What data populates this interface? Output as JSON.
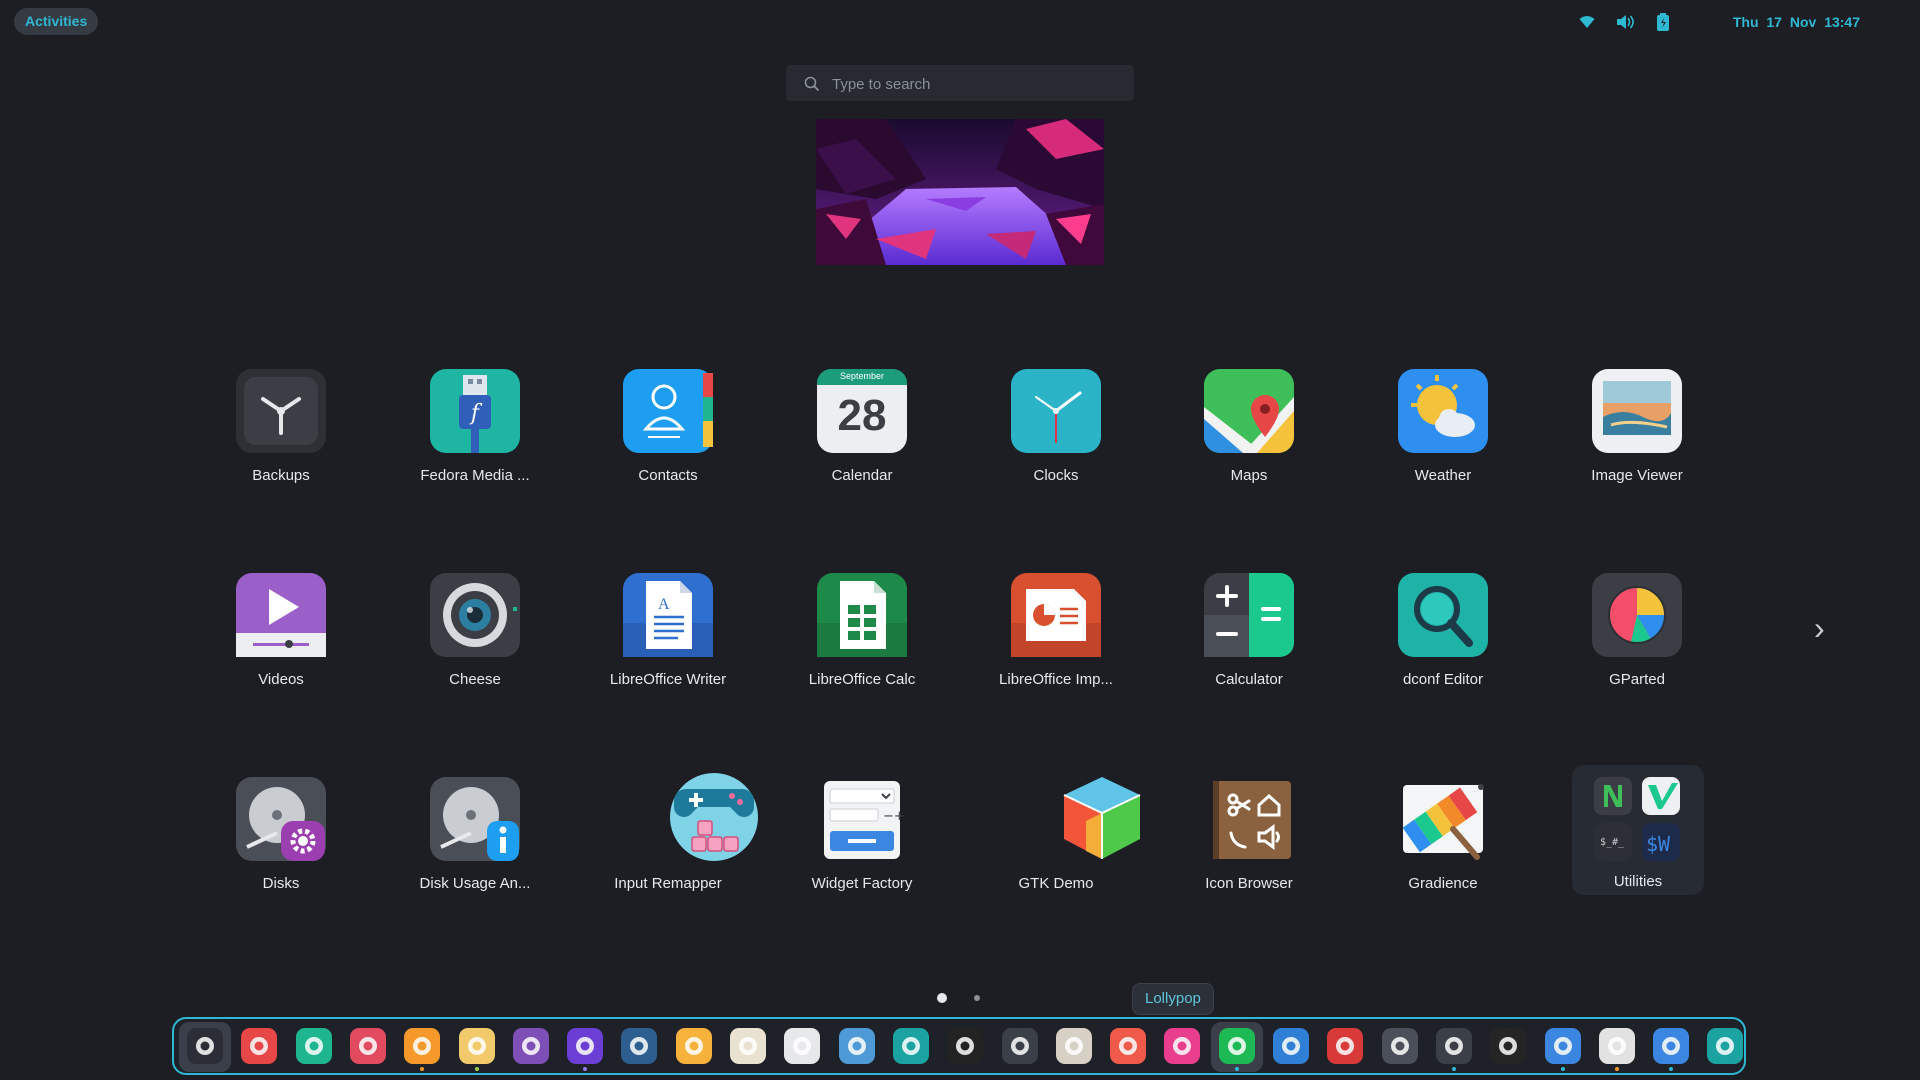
{
  "topbar": {
    "activities_label": "Activities",
    "clock": "Thu 17 Nov  13:47",
    "tray_icons": [
      "wifi-icon",
      "volume-icon",
      "battery-icon"
    ],
    "accent_color": "#2fb8d2"
  },
  "search": {
    "placeholder": "Type to search",
    "value": ""
  },
  "apps": [
    {
      "label": "Backups",
      "icon": "backups-icon"
    },
    {
      "label": "Fedora Media ...",
      "icon": "usb-icon"
    },
    {
      "label": "Contacts",
      "icon": "contacts-icon"
    },
    {
      "label": "Calendar",
      "icon": "calendar-icon",
      "calendar_month": "September",
      "calendar_day": "28"
    },
    {
      "label": "Clocks",
      "icon": "clock-icon"
    },
    {
      "label": "Maps",
      "icon": "maps-icon"
    },
    {
      "label": "Weather",
      "icon": "weather-icon"
    },
    {
      "label": "Image Viewer",
      "icon": "image-viewer-icon"
    },
    {
      "label": "Videos",
      "icon": "videos-icon"
    },
    {
      "label": "Cheese",
      "icon": "camera-icon"
    },
    {
      "label": "LibreOffice Writer",
      "icon": "writer-icon"
    },
    {
      "label": "LibreOffice Calc",
      "icon": "calc-icon"
    },
    {
      "label": "LibreOffice Imp...",
      "icon": "impress-icon"
    },
    {
      "label": "Calculator",
      "icon": "calculator-icon"
    },
    {
      "label": "dconf Editor",
      "icon": "dconf-icon"
    },
    {
      "label": "GParted",
      "icon": "gparted-icon"
    },
    {
      "label": "Disks",
      "icon": "disks-icon"
    },
    {
      "label": "Disk Usage An...",
      "icon": "disk-usage-icon"
    },
    {
      "label": "Input Remapper",
      "icon": "gamepad-icon"
    },
    {
      "label": "Widget Factory",
      "icon": "widget-factory-icon"
    },
    {
      "label": "GTK Demo",
      "icon": "gtk-cube-icon"
    },
    {
      "label": "Icon Browser",
      "icon": "icon-browser-icon"
    },
    {
      "label": "Gradience",
      "icon": "gradience-icon"
    },
    {
      "label": "Utilities",
      "icon": "folder-icon",
      "folder": true
    }
  ],
  "pager": {
    "pages": 2,
    "current": 1
  },
  "tooltip": "Lollypop",
  "dock": [
    {
      "name": "lollypop",
      "icon": "bird-icon",
      "color": "#2b2e36",
      "selected": true
    },
    {
      "name": "app-store",
      "icon": "appstore-icon",
      "color": "#e84747"
    },
    {
      "name": "mail",
      "icon": "mail-icon",
      "color": "#1fb68f"
    },
    {
      "name": "tasks",
      "icon": "check-icon",
      "color": "#e24a5f"
    },
    {
      "name": "brave",
      "icon": "brave-icon",
      "color": "#f59a2a",
      "running_color": "#f59a2a"
    },
    {
      "name": "files",
      "icon": "folder-icon",
      "color": "#f2c96b",
      "running_color": "#9ccf4f"
    },
    {
      "name": "github",
      "icon": "github-icon",
      "color": "#7f4fb8"
    },
    {
      "name": "obsidian",
      "icon": "gem-icon",
      "color": "#6b3ed6",
      "running_color": "#9b7bf0"
    },
    {
      "name": "vscode",
      "icon": "vscode-icon",
      "color": "#2c5f8f"
    },
    {
      "name": "color-picker",
      "icon": "color-picker-icon",
      "color": "#f6b23a"
    },
    {
      "name": "text-editor",
      "icon": "pencil-icon",
      "color": "#e9e2d0"
    },
    {
      "name": "search-tool",
      "icon": "magnifier-icon",
      "color": "#e6e8ec"
    },
    {
      "name": "reader",
      "icon": "book-icon",
      "color": "#4e9ad6"
    },
    {
      "name": "screenshot",
      "icon": "screenshot-icon",
      "color": "#1aa3a0"
    },
    {
      "name": "figma",
      "icon": "figma-icon",
      "color": "#232323"
    },
    {
      "name": "inkscape",
      "icon": "inkscape-icon",
      "color": "#3b3f47"
    },
    {
      "name": "gimp",
      "icon": "gimp-icon",
      "color": "#d7d0c4"
    },
    {
      "name": "pinta",
      "icon": "pinta-icon",
      "color": "#f05a4a"
    },
    {
      "name": "collage",
      "icon": "pinwheel-icon",
      "color": "#e83e8c"
    },
    {
      "name": "spotify",
      "icon": "spotify-icon",
      "color": "#1db954",
      "running_color": "#2fb8d2",
      "selected": true
    },
    {
      "name": "equalizer",
      "icon": "sliders-icon",
      "color": "#2f7fd6"
    },
    {
      "name": "sound-recorder",
      "icon": "waveform-icon",
      "color": "#d83a3a"
    },
    {
      "name": "window-tool",
      "icon": "frame-icon",
      "color": "#4a4f59"
    },
    {
      "name": "terminal",
      "icon": "terminal-icon",
      "color": "#3b3f47",
      "running_color": "#2fb8d2"
    },
    {
      "name": "ardour",
      "icon": "ardour-icon",
      "color": "#252525"
    },
    {
      "name": "extensions",
      "icon": "puzzle-icon",
      "color": "#3b86e0",
      "running_color": "#2fb8d2"
    },
    {
      "name": "layout-tool",
      "icon": "layout-icon",
      "color": "#e2e2e2",
      "running_color": "#f59a2a"
    },
    {
      "name": "settings",
      "icon": "gear-icon",
      "color": "#3b86e0",
      "running_color": "#2fb8d2"
    },
    {
      "name": "trash",
      "icon": "trash-icon",
      "color": "#1aa3a0"
    }
  ]
}
